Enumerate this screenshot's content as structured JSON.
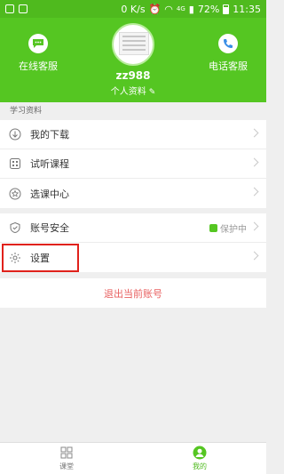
{
  "status_bar": {
    "speed": "0 K/s",
    "network": "4G",
    "battery": "72%",
    "time": "11:35"
  },
  "header": {
    "left_button": "在线客服",
    "right_button": "电话客服",
    "username": "zz988",
    "profile_link": "个人资料"
  },
  "section_title": "学习资料",
  "learning_items": [
    {
      "label": "我的下载",
      "icon": "download-icon"
    },
    {
      "label": "试听课程",
      "icon": "video-icon"
    },
    {
      "label": "选课中心",
      "icon": "star-icon"
    }
  ],
  "security_items": [
    {
      "label": "账号安全",
      "icon": "shield-icon",
      "status": "保护中"
    },
    {
      "label": "设置",
      "icon": "gear-icon"
    }
  ],
  "logout_label": "退出当前账号",
  "bottom_nav": [
    {
      "label": "课堂",
      "icon": "grid-icon",
      "active": false
    },
    {
      "label": "我的",
      "icon": "user-icon",
      "active": true
    }
  ],
  "colors": {
    "brand_green": "#55c622",
    "highlight_red": "#e0211b",
    "logout_red": "#e86060"
  }
}
